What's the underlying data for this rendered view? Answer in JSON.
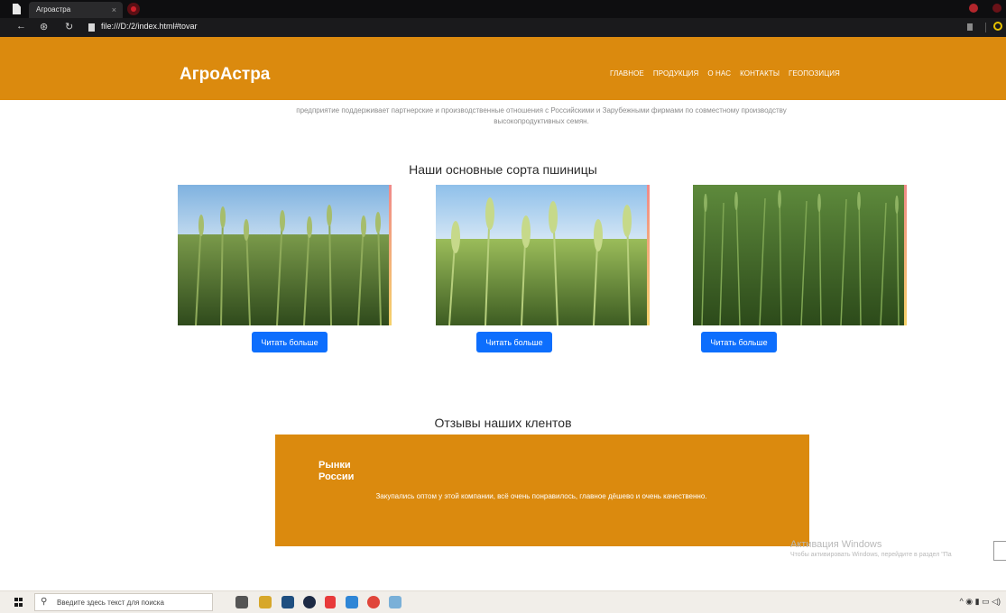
{
  "browser": {
    "tab_title": "Агроастра",
    "tab_close": "×",
    "url": "file:///D:/2/index.html#tovar"
  },
  "header": {
    "brand": "АгроАстра",
    "nav": [
      "ГЛАВНОЕ",
      "ПРОДУКЦИЯ",
      "О НАС",
      "КОНТАКТЫ",
      "ГЕОПОЗИЦИЯ"
    ]
  },
  "intro_text": "предприятие поддерживает партнерские и производственные отношения с Российскими и Зарубежными фирмами по совместному производству высокопродуктивных семян.",
  "products": {
    "title": "Наши основные сорта пшиницы",
    "button_label": "Читать больше"
  },
  "reviews": {
    "title": "Отзывы наших клентов",
    "author": "Рынки России",
    "text": "Закупались оптом у этой компании, всё очень понравилось, главное дёшево и очень качественно."
  },
  "activation": {
    "title": "Активация Windows",
    "subtitle": "Чтобы активировать Windows, перейдите в раздел \"Па"
  },
  "taskbar": {
    "search_placeholder": "Введите здесь текст для поиска"
  }
}
